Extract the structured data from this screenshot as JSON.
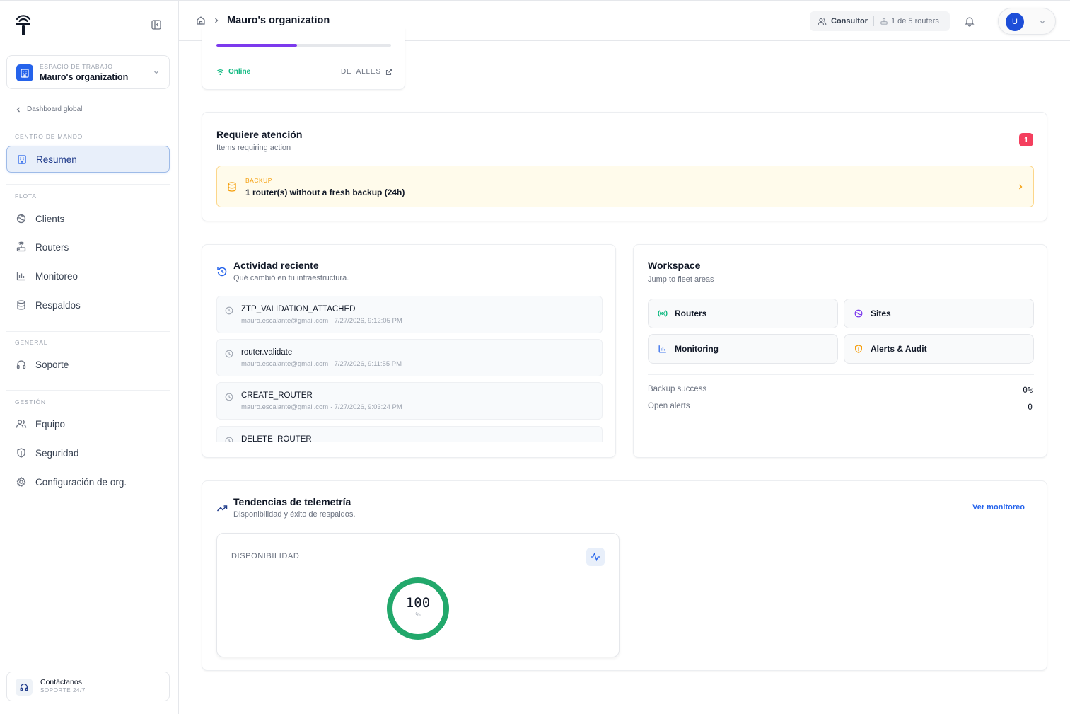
{
  "sidebar": {
    "workspace_label": "ESPACIO DE TRABAJO",
    "workspace_name": "Mauro's organization",
    "back_link": "Dashboard global",
    "sections": {
      "command": "CENTRO DE MANDO",
      "fleet": "FLOTA",
      "general": "GENERAL",
      "management": "GESTIÓN"
    },
    "items": {
      "summary": "Resumen",
      "clients": "Clients",
      "routers": "Routers",
      "monitoring": "Monitoreo",
      "backups": "Respaldos",
      "support": "Soporte",
      "team": "Equipo",
      "security": "Seguridad",
      "org_settings": "Configuración de org."
    },
    "contact": {
      "title": "Contáctanos",
      "subtitle": "SOPORTE 24/7"
    }
  },
  "header": {
    "breadcrumb": "Mauro's organization",
    "role": "Consultor",
    "router_quota": "1 de 5 routers",
    "avatar_initial": "U"
  },
  "router_card": {
    "progress": 0.46,
    "status": "Online",
    "details_label": "DETALLES"
  },
  "attention": {
    "title": "Requiere atención",
    "subtitle": "Items requiring action",
    "count": "1",
    "alert": {
      "tag": "BACKUP",
      "text": "1 router(s) without a fresh backup (24h)"
    }
  },
  "activity": {
    "title": "Actividad reciente",
    "subtitle": "Qué cambió en tu infraestructura.",
    "items": [
      {
        "name": "ZTP_VALIDATION_ATTACHED",
        "meta": "mauro.escalante@gmail.com · 7/27/2026, 9:12:05 PM"
      },
      {
        "name": "router.validate",
        "meta": "mauro.escalante@gmail.com · 7/27/2026, 9:11:55 PM"
      },
      {
        "name": "CREATE_ROUTER",
        "meta": "mauro.escalante@gmail.com · 7/27/2026, 9:03:24 PM"
      },
      {
        "name": "DELETE_ROUTER",
        "meta": ""
      }
    ]
  },
  "workspace": {
    "title": "Workspace",
    "subtitle": "Jump to fleet areas",
    "links": {
      "routers": "Routers",
      "sites": "Sites",
      "monitoring": "Monitoring",
      "alerts": "Alerts & Audit"
    },
    "stats": {
      "backup_label": "Backup success",
      "backup_value": "0%",
      "alerts_label": "Open alerts",
      "alerts_value": "0"
    }
  },
  "telemetry": {
    "title": "Tendencias de telemetría",
    "subtitle": "Disponibilidad y éxito de respaldos.",
    "view_link": "Ver monitoreo",
    "availability_label": "DISPONIBILIDAD",
    "availability_value": "100",
    "availability_unit": "%",
    "availability_fraction": 1.0
  },
  "colors": {
    "accent": "#2563eb",
    "progress": "#7c3aed",
    "online": "#10b981",
    "warning": "#f59e0b",
    "danger": "#f43f5e",
    "gauge": "#22a86b"
  }
}
